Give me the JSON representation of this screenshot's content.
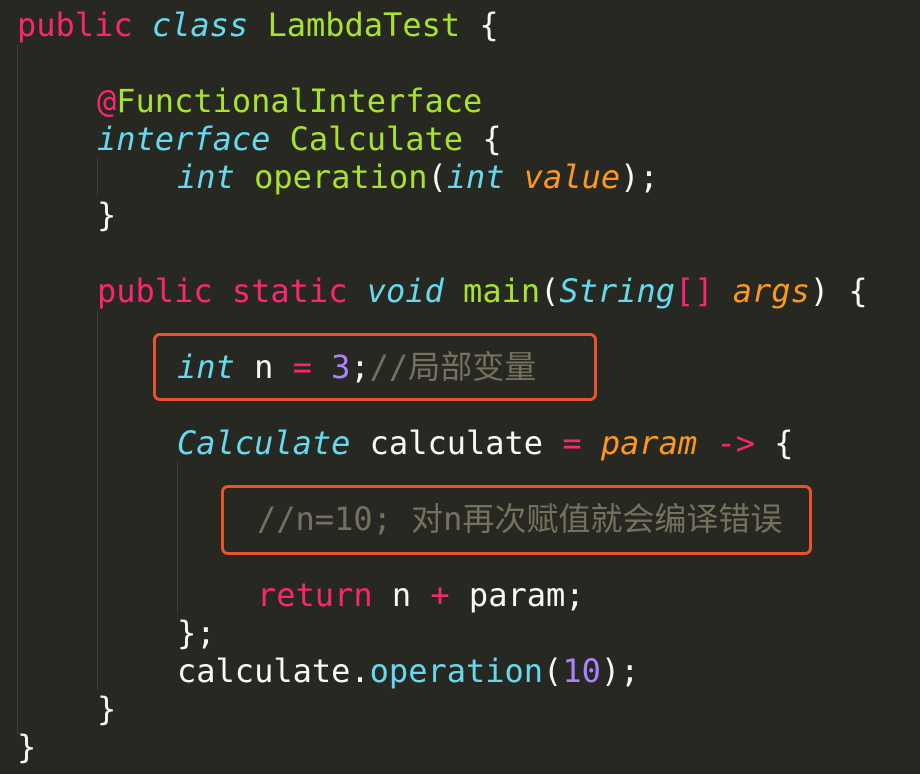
{
  "code": {
    "l1": {
      "public": "public",
      "class": "class",
      "name": "LambdaTest",
      "brace": "{"
    },
    "l3": {
      "annotation_at": "@",
      "annotation": "FunctionalInterface"
    },
    "l4": {
      "interface": "interface",
      "name": "Calculate",
      "brace": "{"
    },
    "l5": {
      "type": "int",
      "method": "operation",
      "open": "(",
      "ptype": "int",
      "param": "value",
      "close": ");"
    },
    "l6": {
      "brace": "}"
    },
    "l8": {
      "public": "public",
      "static": "static",
      "void": "void",
      "method": "main",
      "open": "(",
      "ptype": "String",
      "brackets": "[]",
      "param": "args",
      "close": ") {"
    },
    "l10": {
      "type": "int",
      "var": "n",
      "eq": "=",
      "val": "3",
      "semi": ";",
      "comment": "//局部变量"
    },
    "l12": {
      "type": "Calculate",
      "var": "calculate",
      "eq": "=",
      "param": "param",
      "arrow": "->",
      "brace": "{"
    },
    "l14": {
      "comment": "//n=10; 对n再次赋值就会编译错误"
    },
    "l16": {
      "return": "return",
      "var": "n",
      "plus": "+",
      "param": "param",
      "semi": ";"
    },
    "l17": {
      "close": "};"
    },
    "l18": {
      "obj": "calculate",
      "dot": ".",
      "method": "operation",
      "open": "(",
      "arg": "10",
      "close": ");"
    },
    "l19": {
      "brace": "}"
    },
    "l20": {
      "brace": "}"
    }
  },
  "colors": {
    "background": "#272822",
    "keyword": "#f92672",
    "storage": "#66d9ef",
    "entity": "#a6e22e",
    "argument": "#fd971f",
    "number": "#ae81ff",
    "comment": "#75715e",
    "highlight_box": "#e8542c"
  }
}
